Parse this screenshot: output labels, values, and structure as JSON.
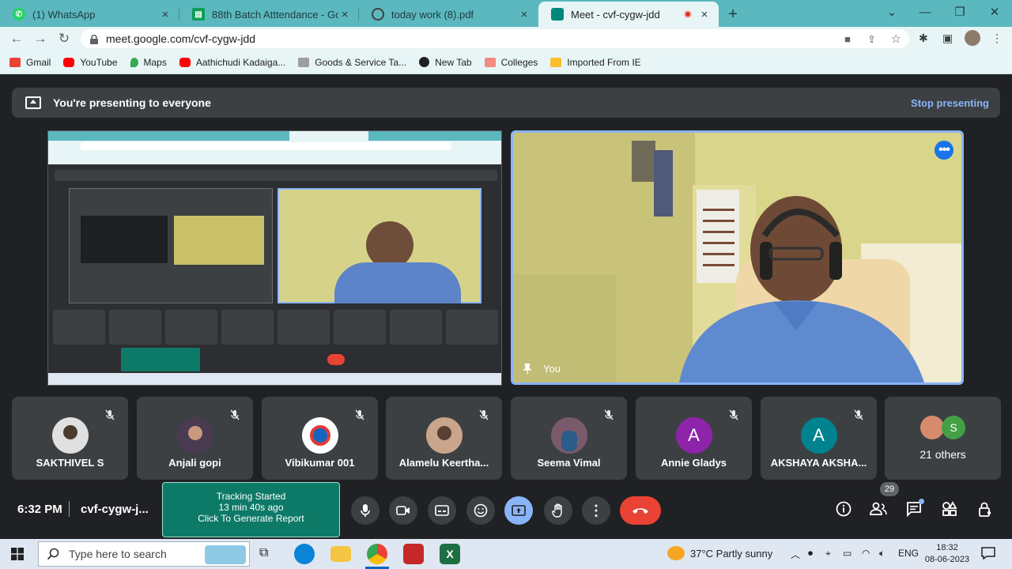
{
  "browser": {
    "tabs": [
      {
        "title": "(1) WhatsApp",
        "icon": "whatsapp-icon",
        "color": "#25d366",
        "active": false
      },
      {
        "title": "88th Batch Atttendance - Google Sheets",
        "icon": "sheets-icon",
        "color": "#0f9d58",
        "active": false
      },
      {
        "title": "today work (8).pdf",
        "icon": "globe-icon",
        "color": "#5f6368",
        "active": false
      },
      {
        "title": "Meet - cvf-cygw-jdd",
        "icon": "meet-icon",
        "color": "#00897b",
        "active": true
      }
    ],
    "new_tab_glyph": "+",
    "close_glyph": "×",
    "url": "meet.google.com/cvf-cygw-jdd",
    "bookmarks": [
      {
        "label": "Gmail",
        "color": "#ea4335"
      },
      {
        "label": "YouTube",
        "color": "#ff0000"
      },
      {
        "label": "Maps",
        "color": "#34a853"
      },
      {
        "label": "Aathichudi Kadaiga...",
        "color": "#ff0000"
      },
      {
        "label": "Goods & Service Ta...",
        "color": "#9e9e9e"
      },
      {
        "label": "New Tab",
        "color": "#202124"
      },
      {
        "label": "Colleges",
        "color": "#f28b82"
      },
      {
        "label": "Imported From IE",
        "color": "#fbc02d"
      }
    ]
  },
  "meet": {
    "banner_text": "You're presenting to everyone",
    "stop_presenting": "Stop presenting",
    "self_label": "You",
    "participants": [
      {
        "name": "SAKTHIVEL S",
        "avatar": "photo",
        "color": "#e0e0e0"
      },
      {
        "name": "Anjali gopi",
        "avatar": "photo",
        "color": "#4a3b52"
      },
      {
        "name": "Vibikumar 001",
        "avatar": "photo",
        "color": "#ffffff"
      },
      {
        "name": "Alamelu Keertha...",
        "avatar": "photo",
        "color": "#c9a58c"
      },
      {
        "name": "Seema Vimal",
        "avatar": "photo",
        "color": "#7a5a6a"
      },
      {
        "name": "Annie Gladys",
        "avatar": "A",
        "color": "#8e24aa"
      },
      {
        "name": "AKSHAYA AKSHA...",
        "avatar": "A",
        "color": "#00838f"
      }
    ],
    "others": {
      "label": "21 others",
      "letter": "S",
      "letter_color": "#43a047"
    },
    "clock": "6:32 PM",
    "meeting_code": "cvf-cygw-j...",
    "tracking": {
      "line1": "Tracking Started",
      "line2": "13 min 40s ago",
      "line3": "Click To Generate Report"
    },
    "people_count": "29"
  },
  "taskbar": {
    "search_placeholder": "Type here to search",
    "weather": "37°C  Partly sunny",
    "language": "ENG",
    "time": "18:32",
    "date": "08-06-2023"
  }
}
